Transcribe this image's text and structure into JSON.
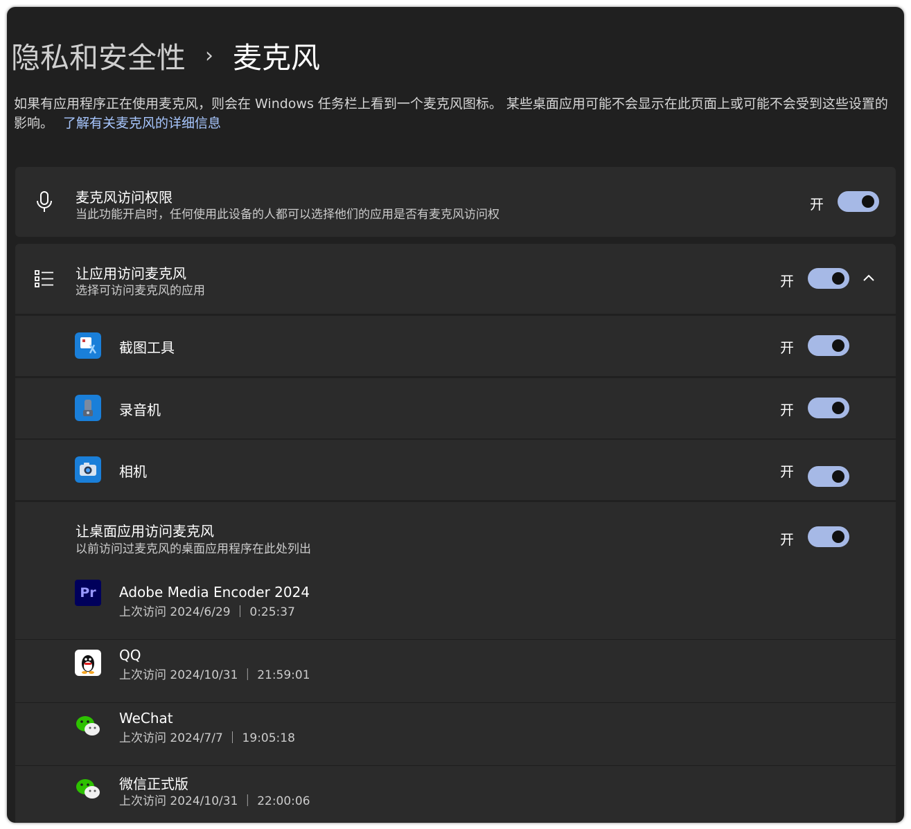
{
  "breadcrumb": {
    "parent": "隐私和安全性",
    "separator": "›",
    "current": "麦克风"
  },
  "description": {
    "text": "如果有应用程序正在使用麦克风，则会在 Windows 任务栏上看到一个麦克风图标。 某些桌面应用可能不会显示在此页面上或可能不会受到这些设置的影响。",
    "link": "了解有关麦克风的详细信息"
  },
  "mic_access": {
    "title": "麦克风访问权限",
    "subtitle": "当此功能开启时，任何使用此设备的人都可以选择他们的应用是否有麦克风访问权",
    "state": "开",
    "icon": "microphone-icon"
  },
  "app_access": {
    "title": "让应用访问麦克风",
    "subtitle": "选择可访问麦克风的应用",
    "state": "开",
    "icon": "list-icon",
    "apps": [
      {
        "name": "截图工具",
        "state": "开",
        "icon": "snipping-tool-icon"
      },
      {
        "name": "录音机",
        "state": "开",
        "icon": "sound-recorder-icon"
      },
      {
        "name": "相机",
        "state": "开",
        "icon": "camera-icon"
      }
    ]
  },
  "desktop_access": {
    "title": "让桌面应用访问麦克风",
    "subtitle": "以前访问过麦克风的桌面应用程序在此处列出",
    "state": "开",
    "apps": [
      {
        "name": "Adobe Media Encoder 2024",
        "last_access": "上次访问 2024/6/29 ｜ 0:25:37",
        "icon_text": "Pr",
        "icon": "adobe-premiere-icon"
      },
      {
        "name": "QQ",
        "last_access": "上次访问 2024/10/31 ｜ 21:59:01",
        "icon": "qq-icon"
      },
      {
        "name": "WeChat",
        "last_access": "上次访问 2024/7/7 ｜ 19:05:18",
        "icon": "wechat-icon"
      },
      {
        "name": "微信正式版",
        "last_access": "上次访问 2024/10/31 ｜ 22:00:06",
        "icon": "wechat-icon"
      }
    ]
  },
  "colors": {
    "background": "#202020",
    "card": "#2b2b2b",
    "accent": "#a6b9e6",
    "link": "#a8c7ff"
  }
}
